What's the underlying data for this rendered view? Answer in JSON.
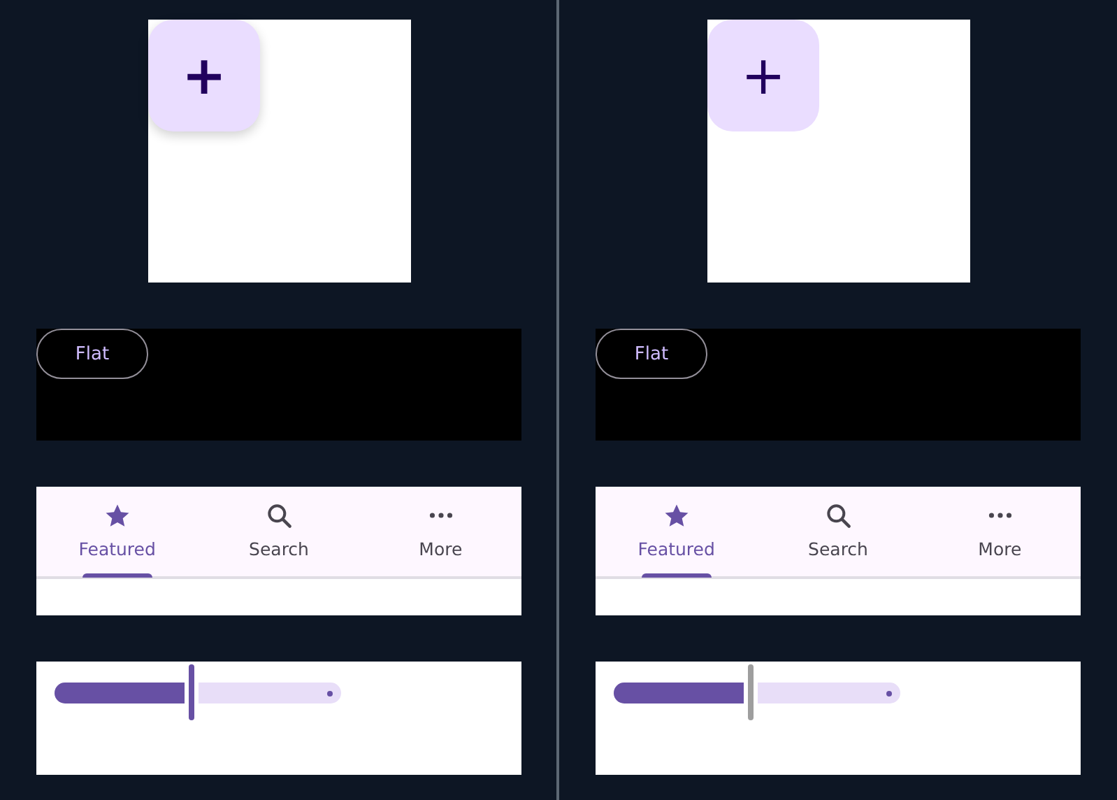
{
  "panels": [
    {
      "fab": {
        "label": "+",
        "elevated": true
      },
      "button": {
        "label": "Flat"
      },
      "tabs": [
        {
          "label": "Featured",
          "selected": true
        },
        {
          "label": "Search",
          "selected": false
        },
        {
          "label": "More",
          "selected": false
        }
      ],
      "slider": {
        "level": 0.5,
        "color": "#6750a4"
      }
    },
    {
      "fab": {
        "label": "+",
        "elevated": false
      },
      "button": {
        "label": "Flat"
      },
      "tabs": [
        {
          "label": "Featured",
          "selected": true
        },
        {
          "label": "Search",
          "selected": false
        },
        {
          "label": "More",
          "selected": false
        }
      ],
      "slider": {
        "level": 0.5,
        "color": "#9e9e9e"
      }
    }
  ]
}
